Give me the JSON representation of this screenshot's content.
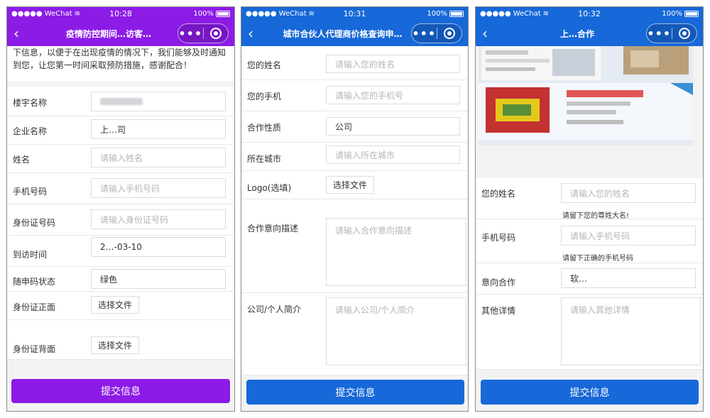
{
  "status": {
    "carrier": "●●●●● WeChat",
    "battery": "100%"
  },
  "phone1": {
    "time": "10:28",
    "title": "疫情防控期间…访客…",
    "intro": "下信息，以便于在出现疫情的情况下，我们能够及时通知到您，让您第一时间采取预防措施，感谢配合！",
    "fields": [
      {
        "label": "楼宇名称",
        "value": ""
      },
      {
        "label": "企业名称",
        "value": "上…司"
      },
      {
        "label": "姓名",
        "placeholder": "请输入姓名"
      },
      {
        "label": "手机号码",
        "placeholder": "请输入手机号码"
      },
      {
        "label": "身份证号码",
        "placeholder": "请输入身份证号码"
      },
      {
        "label": "到访时间",
        "value": "2…-03-10"
      },
      {
        "label": "随申码状态",
        "value": "绿色"
      },
      {
        "label": "身份证正面",
        "button": "选择文件"
      },
      {
        "label": "身份证背面",
        "button": "选择文件"
      }
    ],
    "submit": "提交信息",
    "accent": "#8c1be6"
  },
  "phone2": {
    "time": "10:31",
    "title": "城市合伙人代理商价格查询申…",
    "fields": [
      {
        "label": "您的姓名",
        "placeholder": "请输入您的姓名"
      },
      {
        "label": "您的手机",
        "placeholder": "请输入您的手机号"
      },
      {
        "label": "合作性质",
        "value": "公司"
      },
      {
        "label": "所在城市",
        "placeholder": "请输入所在城市"
      },
      {
        "label": "Logo(选填)",
        "button": "选择文件"
      },
      {
        "label": "合作意向描述",
        "placeholder": "请输入合作意向描述"
      },
      {
        "label": "公司/个人简介",
        "placeholder": "请输入公司/个人简介"
      }
    ],
    "submit": "提交信息",
    "accent": "#1768d8"
  },
  "phone3": {
    "time": "10:32",
    "title": "上…合作",
    "fields": [
      {
        "label": "您的姓名",
        "placeholder": "请输入您的姓名",
        "hint": "请留下您的尊姓大名!"
      },
      {
        "label": "手机号码",
        "placeholder": "请输入手机号码",
        "hint": "请留下正确的手机号码"
      },
      {
        "label": "意向合作",
        "value": "软…"
      },
      {
        "label": "其他详情",
        "placeholder": "请输入其他详情"
      }
    ],
    "submit": "提交信息",
    "accent": "#1768d8"
  }
}
